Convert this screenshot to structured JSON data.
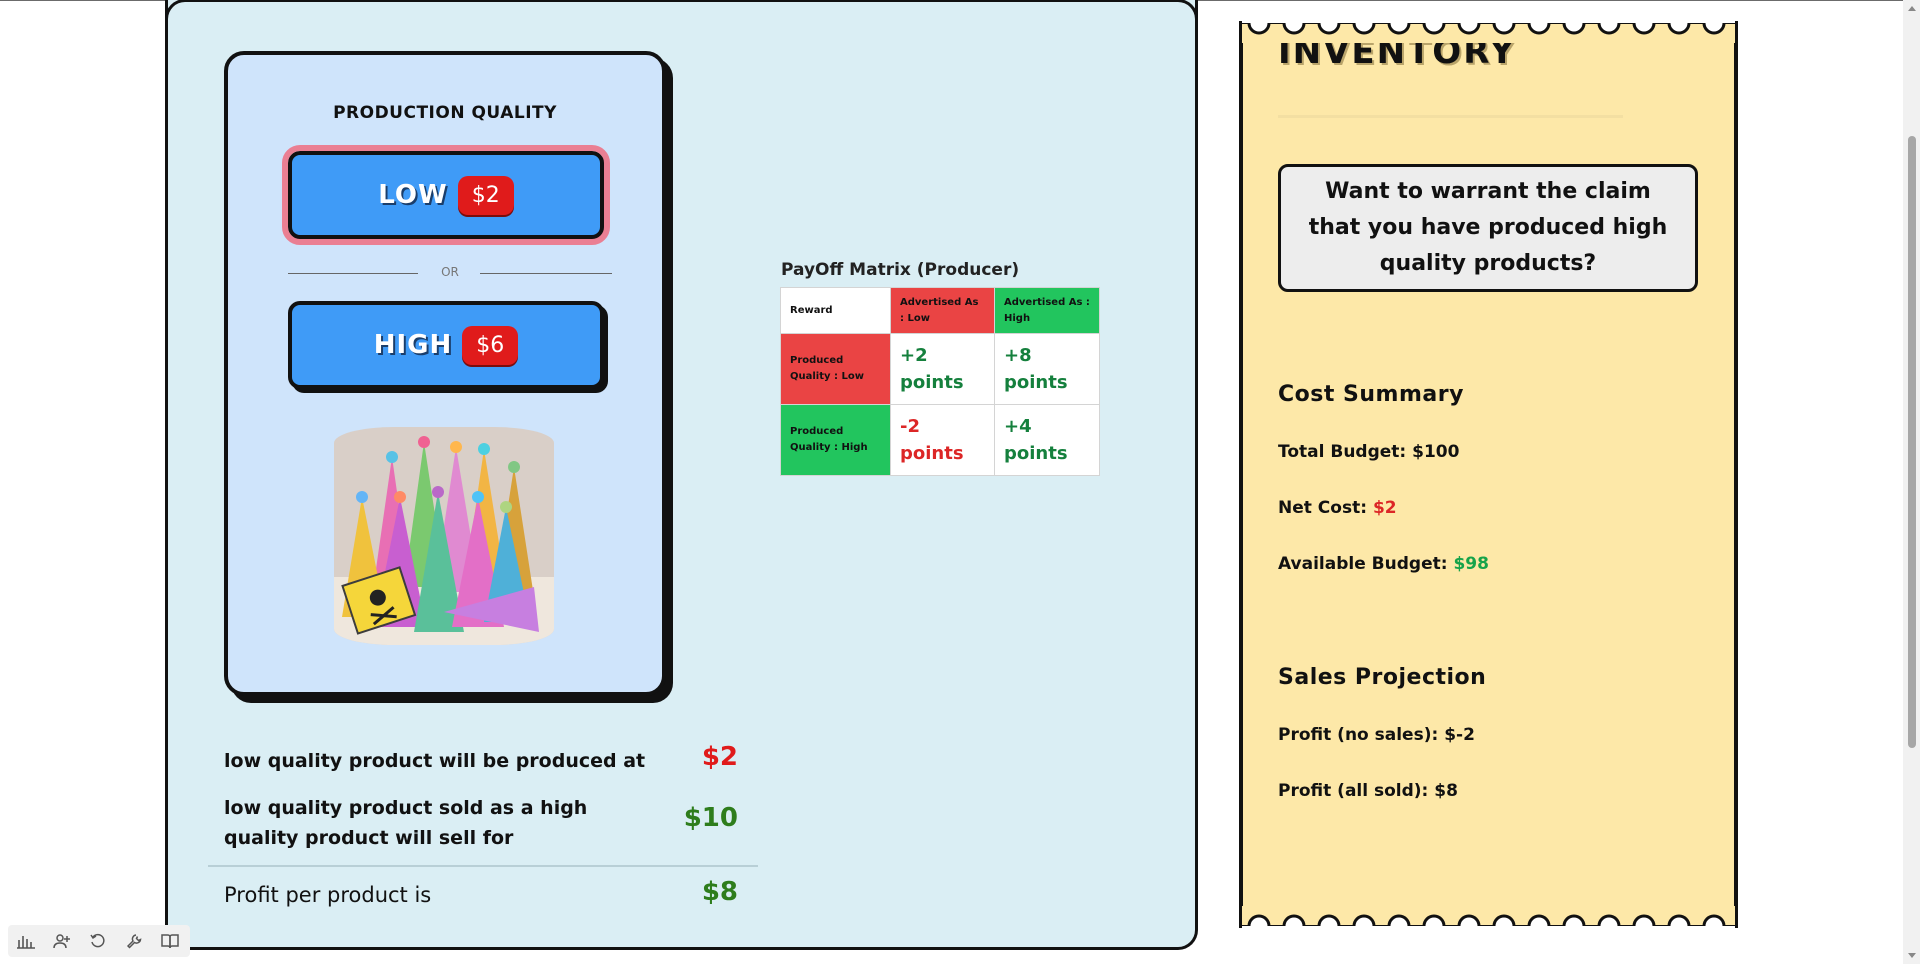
{
  "production": {
    "title": "PRODUCTION QUALITY",
    "low": {
      "label": "LOW",
      "price": "$2"
    },
    "or_text": "OR",
    "high": {
      "label": "HIGH",
      "price": "$6"
    },
    "image_alt": "Party hats with warning sign"
  },
  "profit": {
    "row1": {
      "text": "low quality product will be produced at",
      "value": "$2"
    },
    "row2": {
      "text": "low quality product sold as a high quality product will sell for",
      "value": "$10"
    },
    "row3": {
      "text": "Profit per product is",
      "value": "$8"
    }
  },
  "matrix": {
    "title": "PayOff Matrix (Producer)",
    "corner": "Reward",
    "col_low": "Advertised As : Low",
    "col_high": "Advertised As : High",
    "row_low": "Produced Quality : Low",
    "row_high": "Produced Quality : High",
    "ll": "+2 points",
    "lh": "+8 points",
    "hl": "-2 points",
    "hh": "+4 points"
  },
  "inventory": {
    "title": "INVENTORY",
    "warrant_question": "Want to warrant the claim that you have produced high quality products?",
    "cost_summary": {
      "heading": "Cost Summary",
      "total_budget_label": "Total Budget:",
      "total_budget_value": "$100",
      "net_cost_label": "Net Cost:",
      "net_cost_value": "$2",
      "available_label": "Available Budget:",
      "available_value": "$98"
    },
    "sales_projection": {
      "heading": "Sales Projection",
      "no_sales_label": "Profit (no sales):",
      "no_sales_value": "$-2",
      "all_sold_label": "Profit (all sold):",
      "all_sold_value": "$8"
    }
  },
  "toolbar": {
    "icons": [
      "bar-chart-icon",
      "add-user-icon",
      "refresh-icon",
      "wrench-icon",
      "book-icon"
    ]
  },
  "colors": {
    "panel_bg": "#daeef4",
    "card_bg": "#cfe4fb",
    "button_blue": "#3f9bf7",
    "price_red": "#e01b1b",
    "ticket_bg": "#fde8a8",
    "matrix_red": "#ea4444",
    "matrix_green": "#22c55e"
  }
}
